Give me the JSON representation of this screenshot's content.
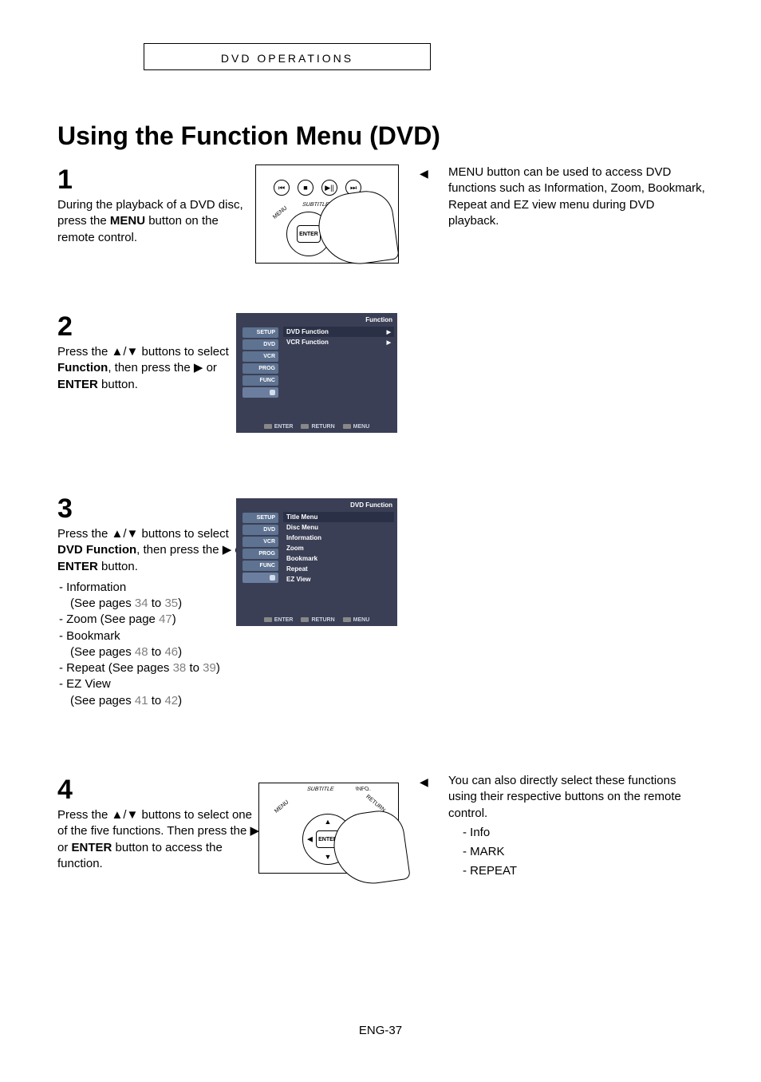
{
  "header": {
    "title_a": "DVD O",
    "title_b": "PERATIONS"
  },
  "page_title": "Using the Function Menu (DVD)",
  "steps": {
    "s1": {
      "num": "1",
      "pre": "During the playback of a DVD disc, press the ",
      "bold": "MENU",
      "post": " button on the remote control."
    },
    "s2": {
      "num": "2",
      "pre": "Press the ▲/▼ buttons to select ",
      "bold": "Function",
      "mid": ", then press the ▶ or ",
      "bold2": "ENTER",
      "post": " button."
    },
    "s3": {
      "num": "3",
      "pre": "Press the ▲/▼ buttons to select ",
      "bold": "DVD Function",
      "mid": ", then press the ▶ or ",
      "bold2": "ENTER",
      "post": " button.",
      "items": [
        {
          "label": "-  Information",
          "sub": "(See pages ",
          "g1": "34",
          "to": " to ",
          "g2": "35",
          "end": ")"
        },
        {
          "label": "-  Zoom (See page ",
          "g1": "47",
          "end": ")"
        },
        {
          "label": "-  Bookmark",
          "sub": "(See pages ",
          "g1": "48",
          "to": " to ",
          "g2": "46",
          "end": ")"
        },
        {
          "label": "-  Repeat (See pages ",
          "g1": "38",
          "to": " to ",
          "g2": "39",
          "end": ")"
        },
        {
          "label": "-  EZ View",
          "sub": "(See pages ",
          "g1": "41",
          "to": " to ",
          "g2": "42",
          "end": ")"
        }
      ]
    },
    "s4": {
      "num": "4",
      "line1": "Press the ▲/▼ buttons to select one of the five functions. Then press the ▶ or ",
      "bold": "ENTER",
      "post": " button to access the function."
    }
  },
  "notes": {
    "n1": "MENU button can be used to access DVD functions such as Information, Zoom, Bookmark, Repeat and EZ view menu during DVD playback.",
    "n2_lead": "You can also directly select these functions using their respective buttons on the remote control.",
    "n2_items": [
      "-   Info",
      "-   MARK",
      "-   REPEAT"
    ]
  },
  "osd": {
    "side": [
      "SETUP",
      "DVD",
      "VCR",
      "PROG",
      "FUNC"
    ],
    "footer": [
      "ENTER",
      "RETURN",
      "MENU"
    ],
    "osd2": {
      "title": "Function",
      "rows": [
        "DVD Function",
        "VCR Function"
      ]
    },
    "osd3": {
      "title": "DVD Function",
      "rows": [
        "Title Menu",
        "Disc Menu",
        "Information",
        "Zoom",
        "Bookmark",
        "Repeat",
        "EZ View"
      ]
    }
  },
  "remote": {
    "subtitle": "SUBTITLE",
    "menu": "MENU",
    "info": "INFO.",
    "return": "RETURN",
    "enter": "ENTER"
  },
  "page_number": "ENG-37"
}
